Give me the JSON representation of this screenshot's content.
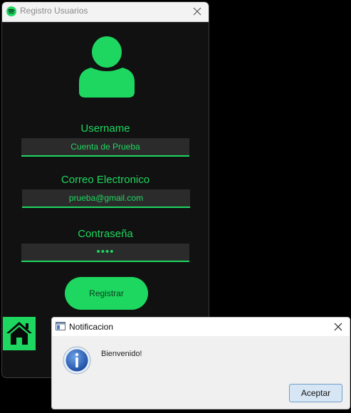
{
  "window": {
    "title": "Registro Usuarios",
    "app_icon": "spotify-icon",
    "close_icon": "close-icon"
  },
  "form": {
    "avatar_icon": "user-icon",
    "username_label": "Username",
    "username_value": "Cuenta de Prueba",
    "email_label": "Correo Electronico",
    "email_value": "prueba@gmail.com",
    "password_label": "Contraseña",
    "password_value": "••••",
    "register_button": "Registrar",
    "home_icon": "home-icon"
  },
  "dialog": {
    "title": "Notificacion",
    "message": "Bienvenido!",
    "ok_button": "Aceptar",
    "info_icon": "info-icon"
  },
  "colors": {
    "accent": "#1ed760",
    "window_bg": "#111111",
    "field_bg": "#2b2b2b",
    "dialog_bg": "#f0f0f0"
  }
}
